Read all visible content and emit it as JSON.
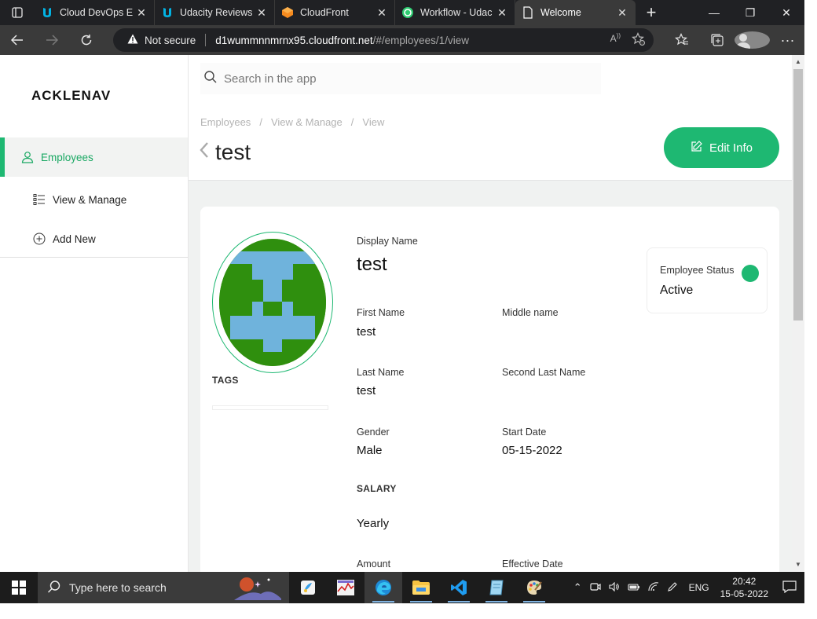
{
  "browser": {
    "tabs": [
      {
        "title": "Cloud DevOps E",
        "favicon": "udacity-icon",
        "active": false
      },
      {
        "title": "Udacity Reviews",
        "favicon": "udacity-icon",
        "active": false
      },
      {
        "title": "CloudFront",
        "favicon": "aws-cloudfront-icon",
        "active": false
      },
      {
        "title": "Workflow - Udac",
        "favicon": "workflow-icon",
        "active": false
      },
      {
        "title": "Welcome",
        "favicon": "page-icon",
        "active": true
      }
    ],
    "security_label": "Not secure",
    "url_host": "d1wummnnmrnx95.cloudfront.net",
    "url_path": "/#/employees/1/view"
  },
  "app": {
    "logo": "ACKLENAV",
    "search_placeholder": "Search in the app",
    "nav": [
      {
        "label": "Employees",
        "icon": "user-icon",
        "active": true
      },
      {
        "label": "View & Manage",
        "icon": "list-icon",
        "active": false
      },
      {
        "label": "Add New",
        "icon": "plus-circle-icon",
        "active": false
      }
    ],
    "breadcrumb": [
      "Employees",
      "View & Manage",
      "View"
    ],
    "page_title": "test",
    "edit_button": "Edit Info"
  },
  "employee": {
    "tags_label": "TAGS",
    "display_name_label": "Display Name",
    "display_name": "test",
    "first_name_label": "First Name",
    "first_name": "test",
    "middle_name_label": "Middle name",
    "middle_name": "",
    "last_name_label": "Last Name",
    "last_name": "test",
    "second_last_name_label": "Second Last Name",
    "second_last_name": "",
    "gender_label": "Gender",
    "gender": "Male",
    "start_date_label": "Start Date",
    "start_date": "05-15-2022",
    "salary_label": "SALARY",
    "salary_type": "Yearly",
    "amount_label": "Amount",
    "effective_date_label": "Effective Date",
    "status_label": "Employee Status",
    "status": "Active",
    "status_color": "#1eb872"
  },
  "taskbar": {
    "search_placeholder": "Type here to search",
    "language": "ENG",
    "time": "20:42",
    "date": "15-05-2022"
  },
  "colors": {
    "accent": "#1eb872",
    "avatar_bg": "#2f8f0e",
    "avatar_fg": "#6fb3dc"
  }
}
